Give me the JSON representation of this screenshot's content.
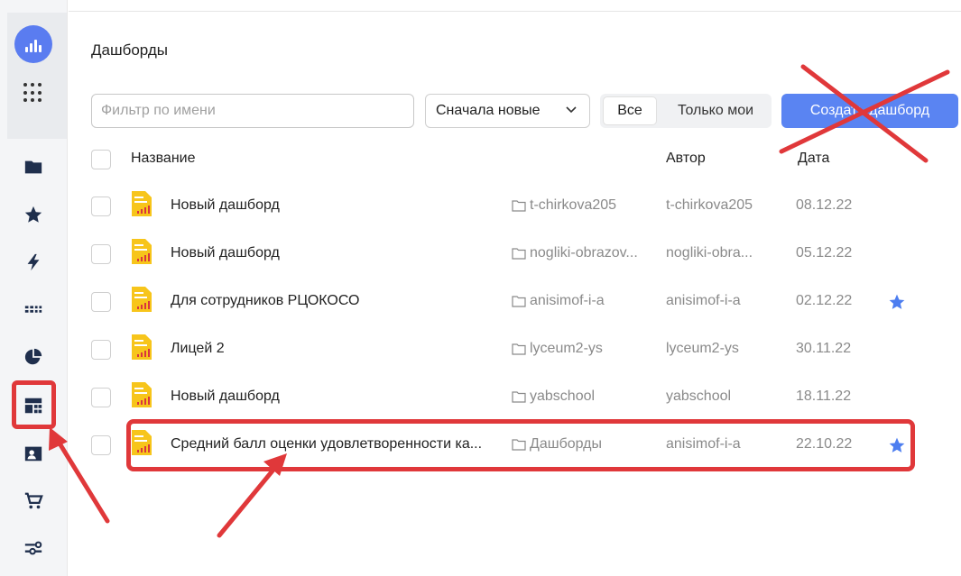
{
  "page": {
    "title": "Дашборды"
  },
  "toolbar": {
    "filter_placeholder": "Фильтр по имени",
    "sort_value": "Сначала новые",
    "segment_all": "Все",
    "segment_mine": "Только мои",
    "create_label": "Создать дашборд"
  },
  "table": {
    "headers": {
      "name": "Название",
      "author": "Автор",
      "date": "Дата"
    },
    "rows": [
      {
        "name": "Новый дашборд",
        "folder": "t-chirkova205",
        "author": "t-chirkova205",
        "date": "08.12.22",
        "starred": false
      },
      {
        "name": "Новый дашборд",
        "folder": "nogliki-obrazov...",
        "author": "nogliki-obra...",
        "date": "05.12.22",
        "starred": false
      },
      {
        "name": "Для сотрудников РЦОКОСО",
        "folder": "anisimof-i-a",
        "author": "anisimof-i-a",
        "date": "02.12.22",
        "starred": true
      },
      {
        "name": "Лицей 2",
        "folder": "lyceum2-ys",
        "author": "lyceum2-ys",
        "date": "30.11.22",
        "starred": false
      },
      {
        "name": "Новый дашборд",
        "folder": "yabschool",
        "author": "yabschool",
        "date": "18.11.22",
        "starred": false
      },
      {
        "name": "Средний балл оценки удовлетворенности ка...",
        "folder": "Дашборды",
        "author": "anisimof-i-a",
        "date": "22.10.22",
        "starred": true
      }
    ]
  },
  "sidebar": {
    "icons": [
      "logo-icon",
      "apps-grid-icon",
      "folder-icon",
      "star-icon",
      "bolt-icon",
      "datasets-icon",
      "charts-icon",
      "dashboards-icon",
      "contacts-icon",
      "cart-icon",
      "settings-icon"
    ]
  },
  "colors": {
    "accent": "#5a84f2",
    "annotation": "#e0383a",
    "star": "#4d7ef0",
    "dashboard_icon": "#f7c51b"
  }
}
